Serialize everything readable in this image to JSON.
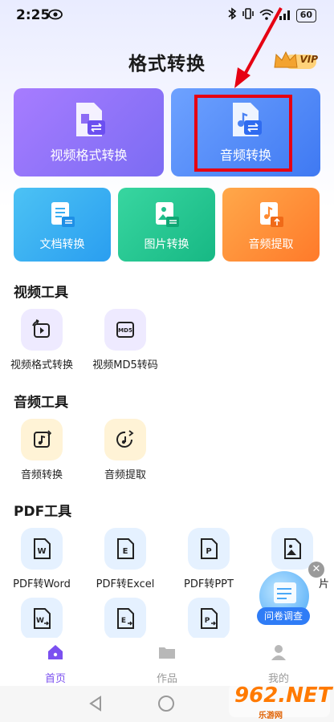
{
  "status": {
    "time": "2:25",
    "battery": "60"
  },
  "header": {
    "title": "格式转换",
    "vip": "VIP"
  },
  "top_cards": {
    "video_format": "视频格式转换",
    "audio_convert": "音频转换"
  },
  "mid_cards": {
    "doc_convert": "文档转换",
    "image_convert": "图片转换",
    "audio_extract": "音频提取"
  },
  "video_tools": {
    "title": "视频工具",
    "items": [
      "视频格式转换",
      "视频MD5转码"
    ]
  },
  "audio_tools": {
    "title": "音频工具",
    "items": [
      "音频转换",
      "音频提取"
    ]
  },
  "pdf_tools": {
    "title": "PDF工具",
    "items": [
      "PDF转Word",
      "PDF转Excel",
      "PDF转PPT",
      "片"
    ]
  },
  "survey": {
    "label": "问卷调查"
  },
  "bottom_nav": {
    "home": "首页",
    "works": "作品",
    "mine": "我的"
  },
  "watermark": {
    "main": "962.NET",
    "sub": "乐游网"
  },
  "colors": {
    "accent": "#7b50f0",
    "highlight": "#e60012"
  }
}
